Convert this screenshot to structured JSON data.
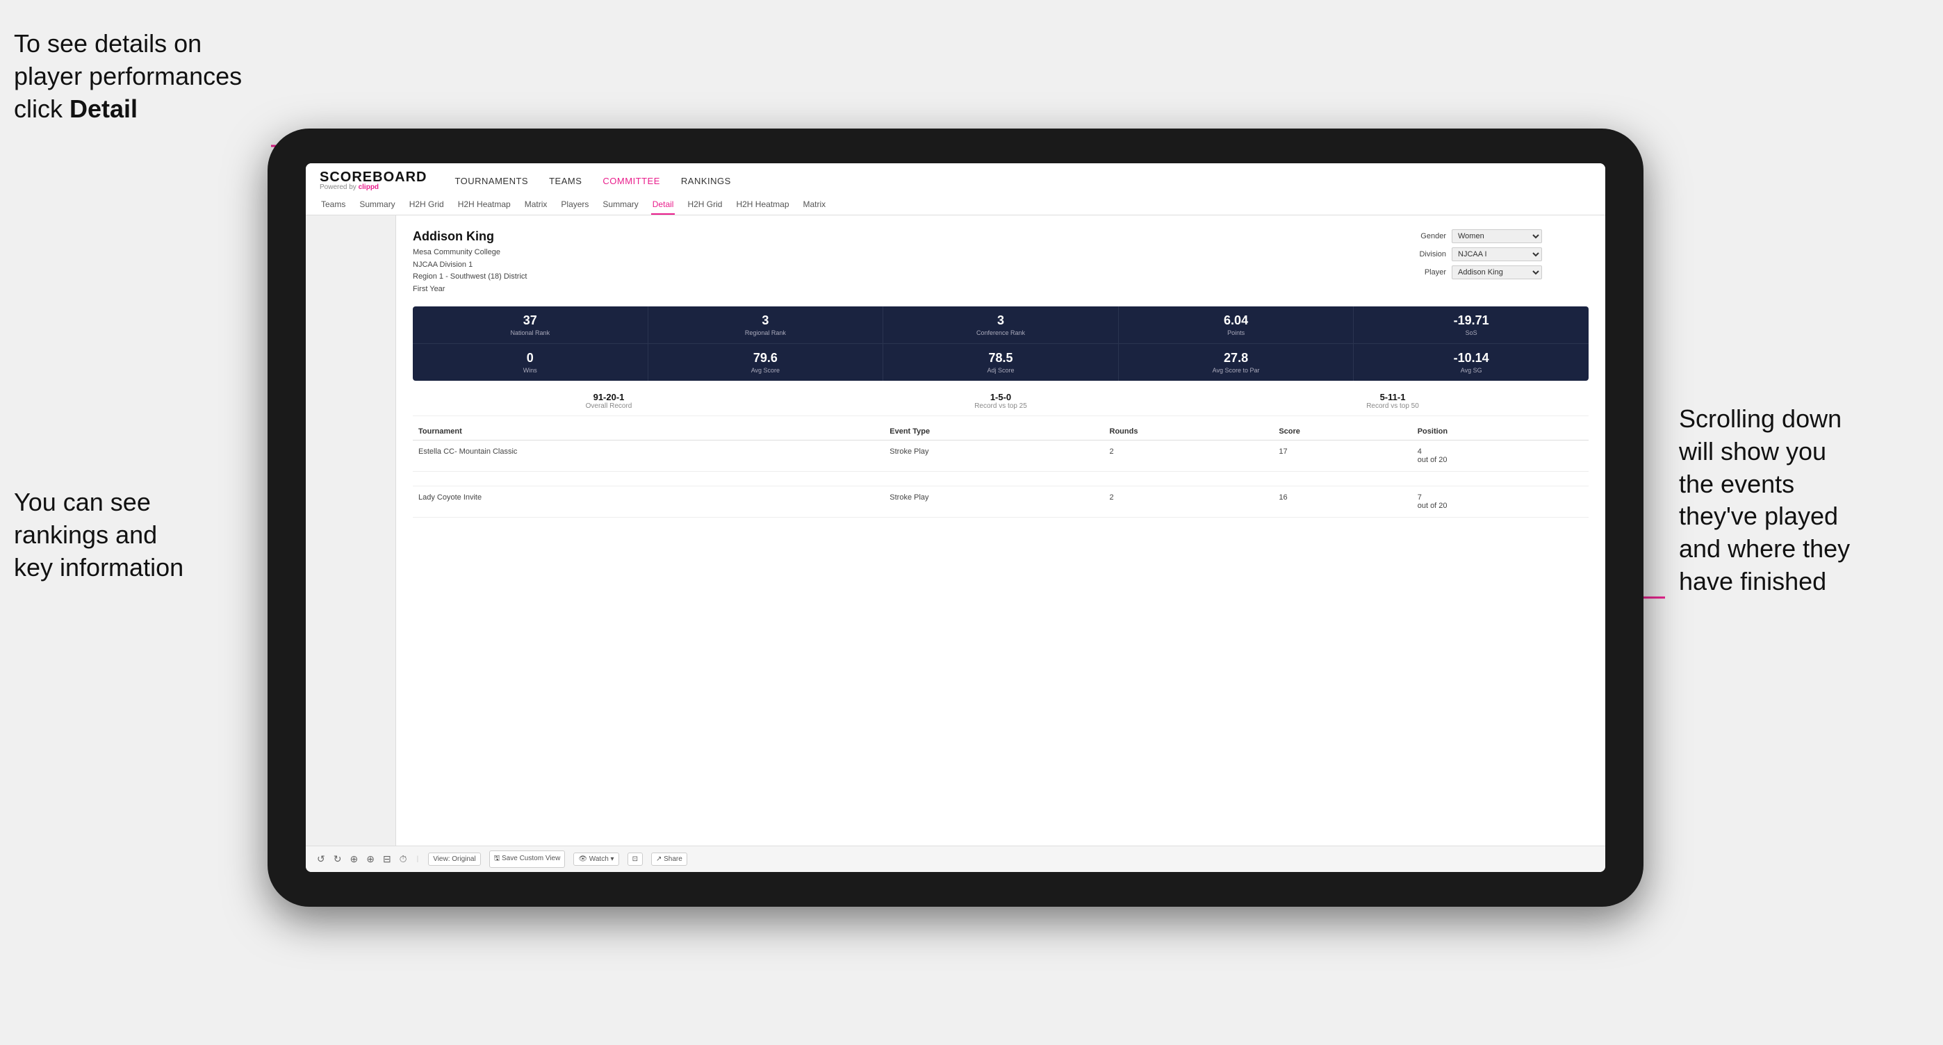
{
  "annotations": {
    "topleft": {
      "line1": "To see details on",
      "line2": "player performances",
      "line3": "click ",
      "bold": "Detail"
    },
    "bottomleft": {
      "line1": "You can see",
      "line2": "rankings and",
      "line3": "key information"
    },
    "right": {
      "line1": "Scrolling down",
      "line2": "will show you",
      "line3": "the events",
      "line4": "they've played",
      "line5": "and where they",
      "line6": "have finished"
    }
  },
  "app": {
    "logo": "SCOREBOARD",
    "powered_by": "Powered by ",
    "clippd": "clippd",
    "nav": [
      "TOURNAMENTS",
      "TEAMS",
      "COMMITTEE",
      "RANKINGS"
    ],
    "subnav": [
      "Teams",
      "Summary",
      "H2H Grid",
      "H2H Heatmap",
      "Matrix",
      "Players",
      "Summary",
      "Detail",
      "H2H Grid",
      "H2H Heatmap",
      "Matrix"
    ],
    "active_nav": "COMMITTEE",
    "active_subnav": "Detail"
  },
  "player": {
    "name": "Addison King",
    "college": "Mesa Community College",
    "division": "NJCAA Division 1",
    "region": "Region 1 - Southwest (18) District",
    "year": "First Year"
  },
  "filters": {
    "gender_label": "Gender",
    "gender_value": "Women",
    "division_label": "Division",
    "division_value": "NJCAA I",
    "player_label": "Player",
    "player_value": "Addison King"
  },
  "stats_row1": [
    {
      "value": "37",
      "label": "National Rank"
    },
    {
      "value": "3",
      "label": "Regional Rank"
    },
    {
      "value": "3",
      "label": "Conference Rank"
    },
    {
      "value": "6.04",
      "label": "Points"
    },
    {
      "value": "-19.71",
      "label": "SoS"
    }
  ],
  "stats_row2": [
    {
      "value": "0",
      "label": "Wins"
    },
    {
      "value": "79.6",
      "label": "Avg Score"
    },
    {
      "value": "78.5",
      "label": "Adj Score"
    },
    {
      "value": "27.8",
      "label": "Avg Score to Par"
    },
    {
      "value": "-10.14",
      "label": "Avg SG"
    }
  ],
  "records": [
    {
      "value": "91-20-1",
      "label": "Overall Record"
    },
    {
      "value": "1-5-0",
      "label": "Record vs top 25"
    },
    {
      "value": "5-11-1",
      "label": "Record vs top 50"
    }
  ],
  "table": {
    "headers": [
      "Tournament",
      "Event Type",
      "Rounds",
      "Score",
      "Position"
    ],
    "rows": [
      {
        "tournament": "Estella CC- Mountain Classic",
        "event_type": "Stroke Play",
        "rounds": "2",
        "score": "17",
        "position": "4\nout of 20"
      },
      {
        "tournament": "Lady Coyote Invite",
        "event_type": "Stroke Play",
        "rounds": "2",
        "score": "16",
        "position": "7\nout of 20"
      }
    ]
  },
  "toolbar": {
    "buttons": [
      "View: Original",
      "Save Custom View",
      "Watch ▾",
      "Share"
    ],
    "icons": [
      "↺",
      "↻",
      "⊕",
      "⊕",
      "▤",
      "⏱"
    ]
  }
}
